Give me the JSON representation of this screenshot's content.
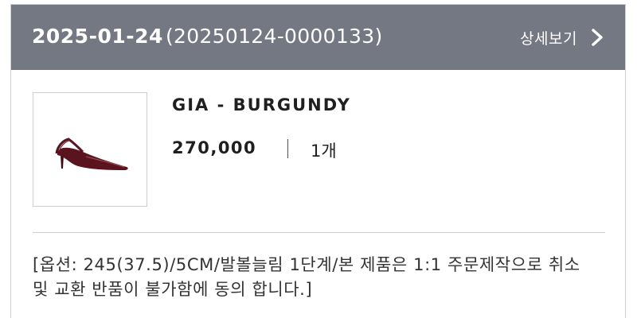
{
  "order": {
    "date": "2025-01-24",
    "number": "(20250124-0000133)",
    "detail_label": "상세보기"
  },
  "product": {
    "name": "GIA - BURGUNDY",
    "price": "270,000",
    "quantity": "1개",
    "options": "[옵션: 245(37.5)/5CM/발볼늘림 1단계/본 제품은 1:1 주문제작으로 취소 및 교환 반품이 불가함에 동의 합니다.]"
  },
  "colors": {
    "header_bg": "#747882",
    "shoe": "#5a1420"
  },
  "icons": {
    "detail": "chevron-right-icon",
    "thumbnail": "burgundy-slingback-pump"
  }
}
